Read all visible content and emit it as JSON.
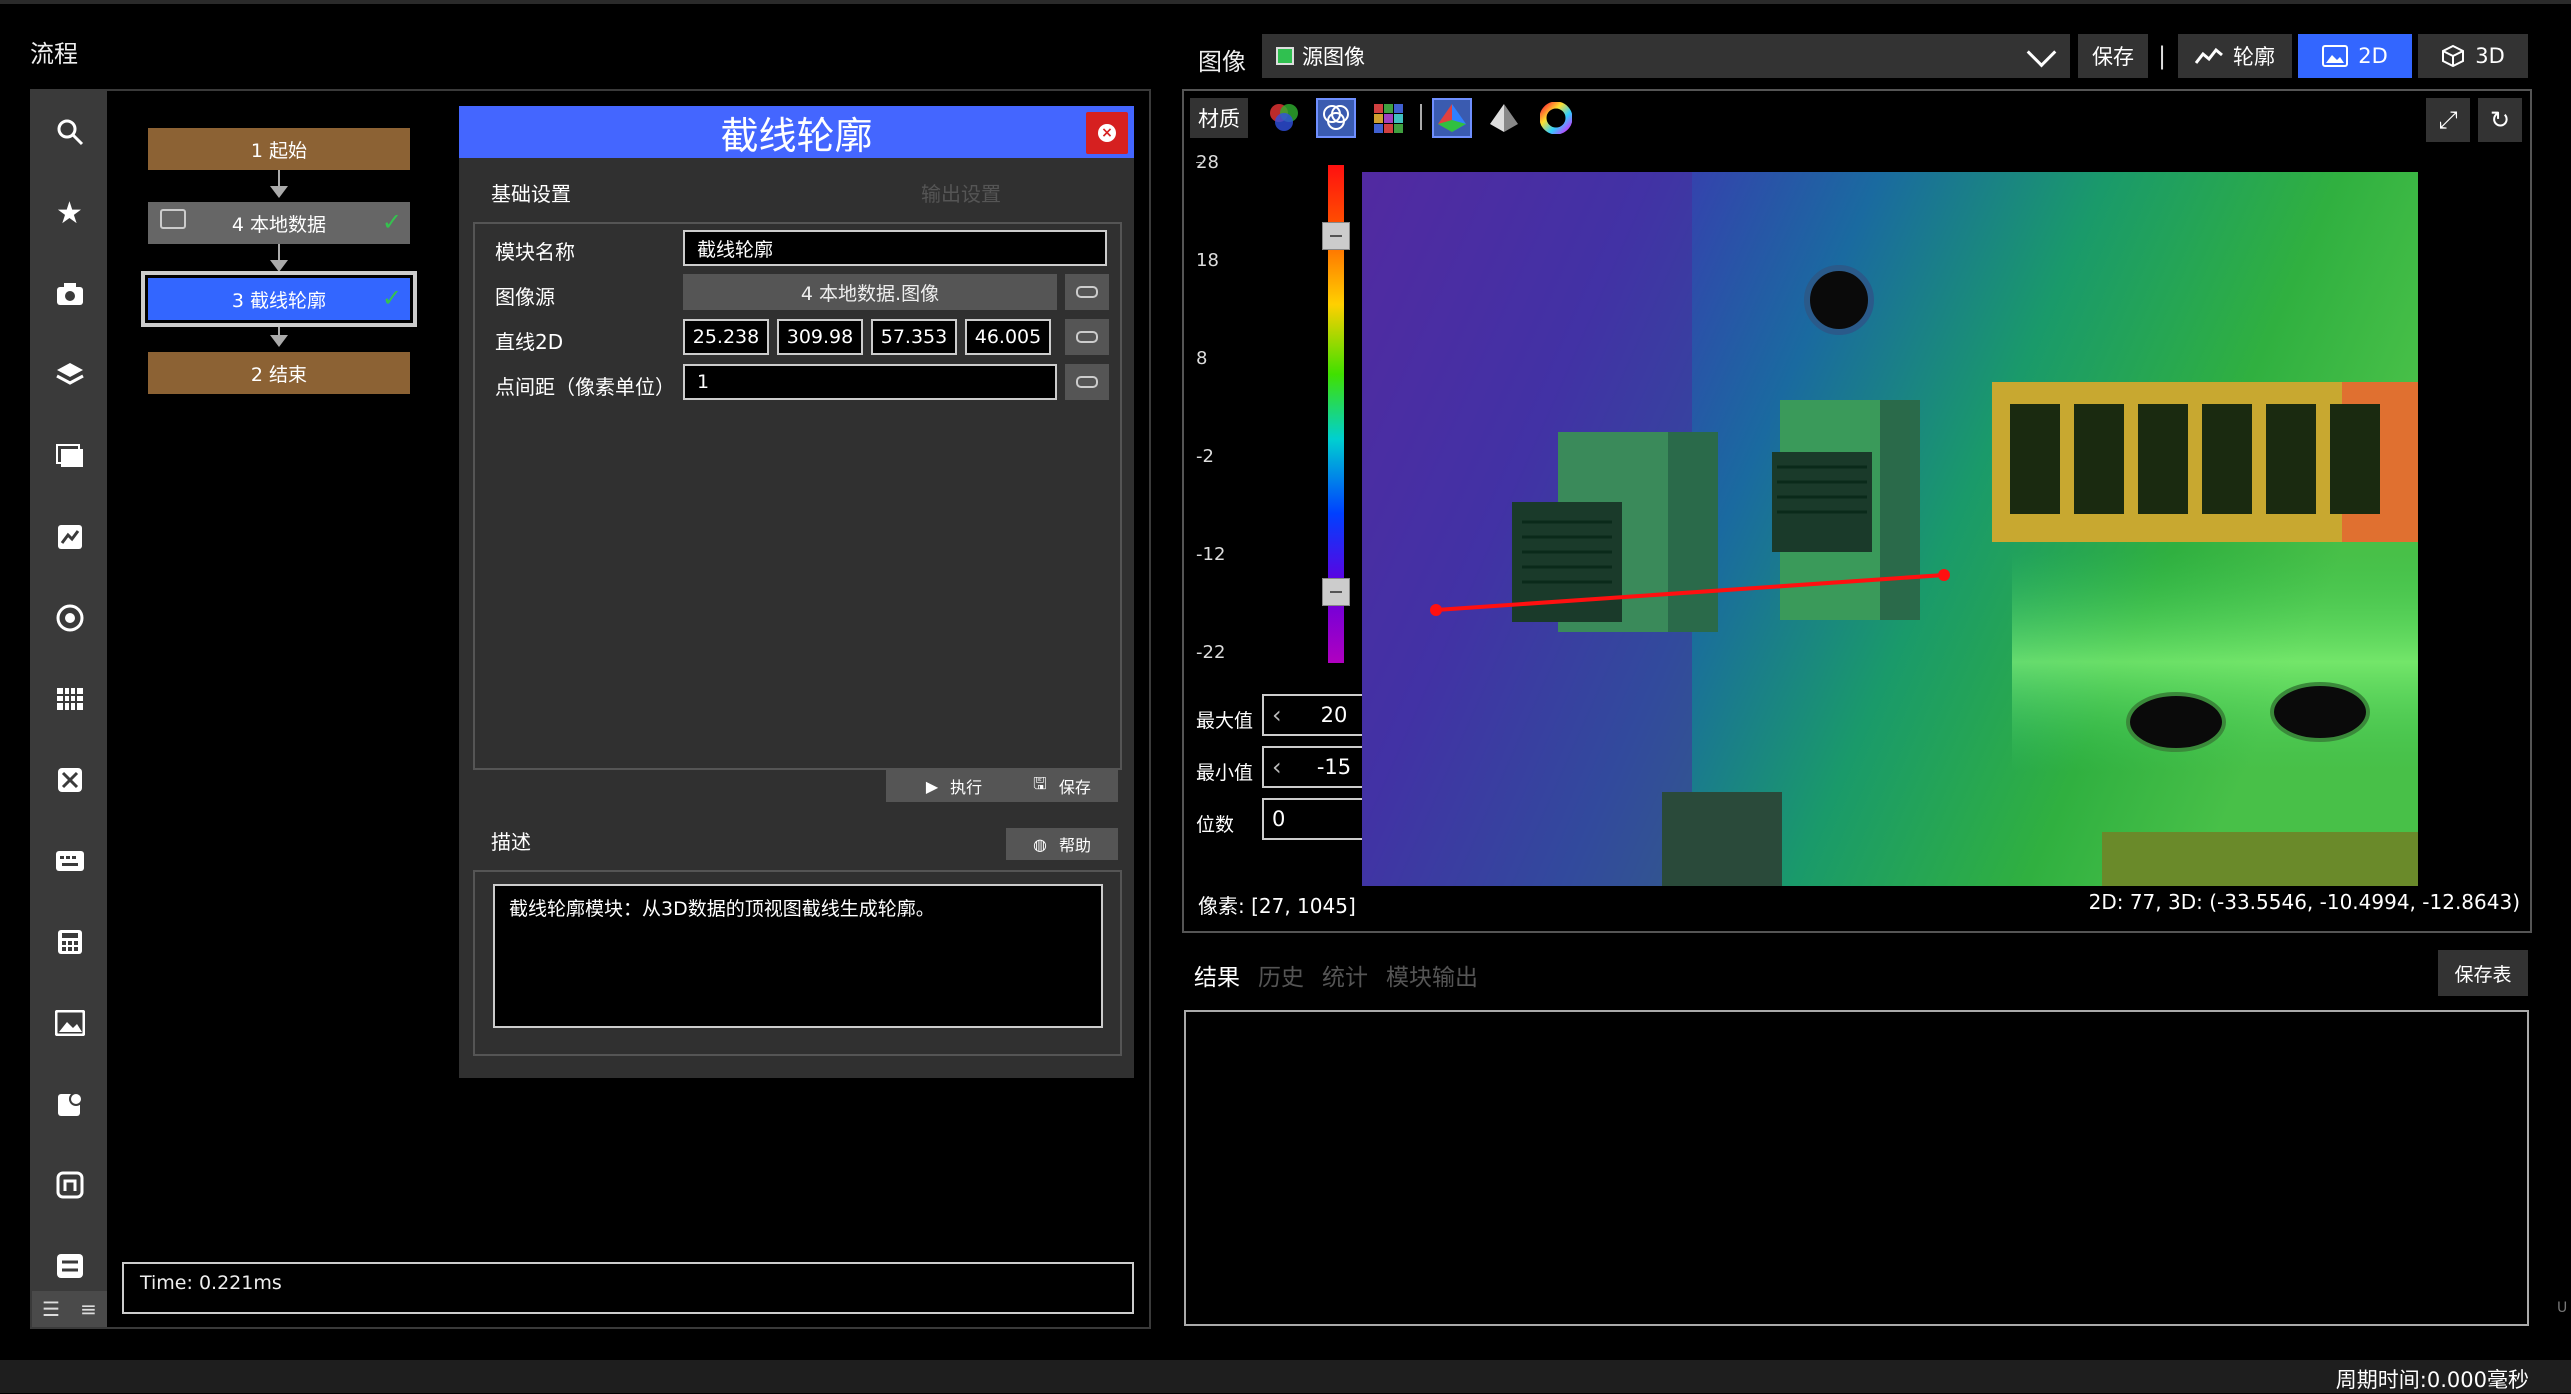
{
  "flow": {
    "title": "流程",
    "nodes": [
      {
        "label": "1 起始"
      },
      {
        "label": "4 本地数据"
      },
      {
        "label": "3 截线轮廓"
      },
      {
        "label": "2 结束"
      }
    ],
    "time": "Time: 0.221ms"
  },
  "sidebar": {
    "icons": [
      "search-icon",
      "star-icon",
      "camera-icon",
      "layers-icon",
      "frames-icon",
      "image-edit-icon",
      "target-icon",
      "grid-icon",
      "tools-icon",
      "keyboard-icon",
      "calculator-icon",
      "picture-icon",
      "clock-window-icon",
      "loop-icon",
      "transfer-icon"
    ]
  },
  "dialog": {
    "title": "截线轮廓",
    "tabs": {
      "basic": "基础设置",
      "output": "输出设置"
    },
    "fields": {
      "module_name_label": "模块名称",
      "module_name_value": "截线轮廓",
      "image_source_label": "图像源",
      "image_source_value": "4 本地数据.图像",
      "line2d_label": "直线2D",
      "line2d_values": [
        "25.238",
        "309.98",
        "57.353",
        "46.005"
      ],
      "spacing_label": "点间距（像素单位）",
      "spacing_value": "1"
    },
    "buttons": {
      "run": "执行",
      "save": "保存",
      "help": "帮助"
    },
    "description_title": "描述",
    "description": "截线轮廓模块：从3D数据的顶视图截线生成轮廓。"
  },
  "image_panel": {
    "title": "图像",
    "source": "源图像",
    "save": "保存",
    "separator": "|",
    "profile": "轮廓",
    "mode_2d": "2D",
    "mode_3d": "3D",
    "material": "材质",
    "scale_labels": [
      "28",
      "18",
      "8",
      "-2",
      "-12",
      "-22"
    ],
    "max_label": "最大值",
    "max_value": "20",
    "min_label": "最小值",
    "min_value": "-15",
    "digits_label": "位数",
    "digits_value": "0",
    "pixel_readout": "像素: [27, 1045]",
    "coord_readout": "2D: 77, 3D: (-33.5546, -10.4994, -12.8643)",
    "accent": "#3366ff"
  },
  "results": {
    "tabs": [
      "结果",
      "历史",
      "统计",
      "模块输出"
    ],
    "save_table": "保存表"
  },
  "status": {
    "cycle_time": "周期时间:0.000毫秒",
    "edge_mark": "U"
  }
}
